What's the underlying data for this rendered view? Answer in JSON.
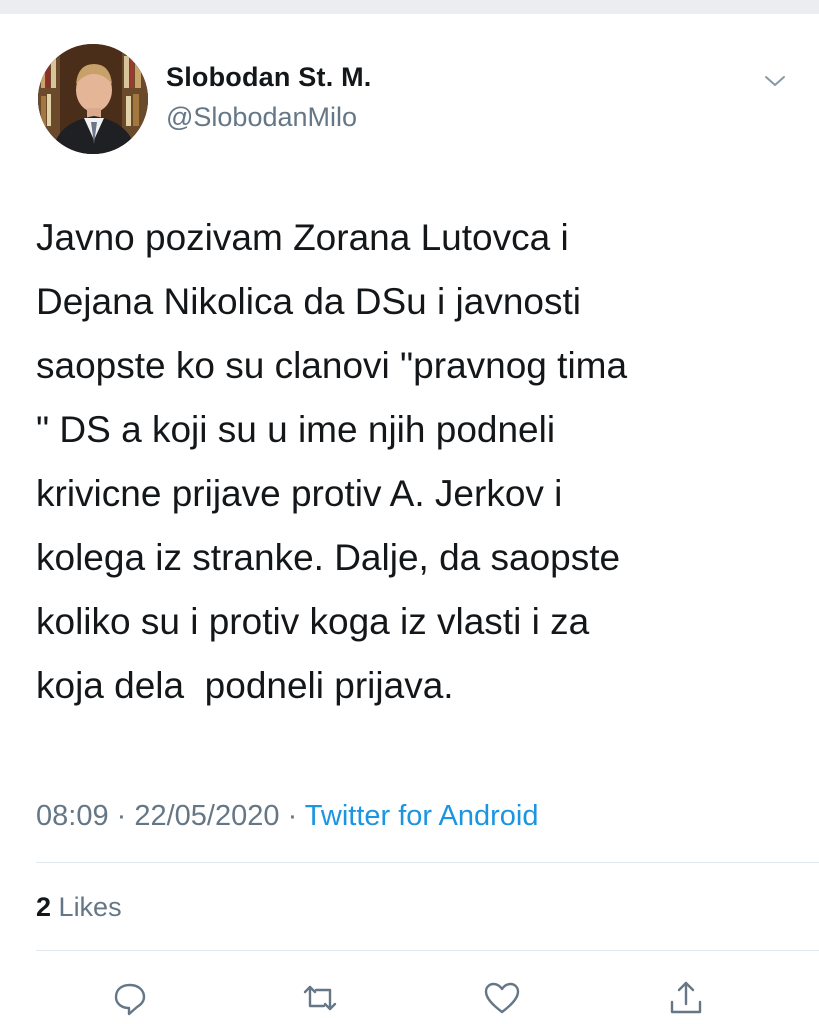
{
  "author": {
    "display_name": "Slobodan St. M.",
    "handle": "@SlobodanMilo",
    "avatar_icon": "profile-photo"
  },
  "tweet": {
    "lines": [
      "Javno pozivam Zorana Lutovca i",
      "Dejana Nikolica da DSu i javnosti",
      "saopste ko su clanovi \"pravnog tima",
      "\" DS a koji su u ime njih podneli",
      "krivicne prijave protiv A. Jerkov i",
      "kolega iz stranke. Dalje, da saopste",
      "koliko su i protiv koga iz vlasti i za",
      "koja dela  podneli prijava."
    ]
  },
  "meta": {
    "time": "08:09",
    "separator": " · ",
    "date": "22/05/2020",
    "source": "Twitter for Android"
  },
  "engagement": {
    "likes_count": "2",
    "likes_label": "Likes"
  },
  "actions": {
    "icons": [
      "reply-icon",
      "retweet-icon",
      "like-icon",
      "share-icon"
    ]
  },
  "colors": {
    "text_primary": "#14171a",
    "text_secondary": "#657786",
    "link": "#1b95e0",
    "divider": "#e1e8ed"
  }
}
